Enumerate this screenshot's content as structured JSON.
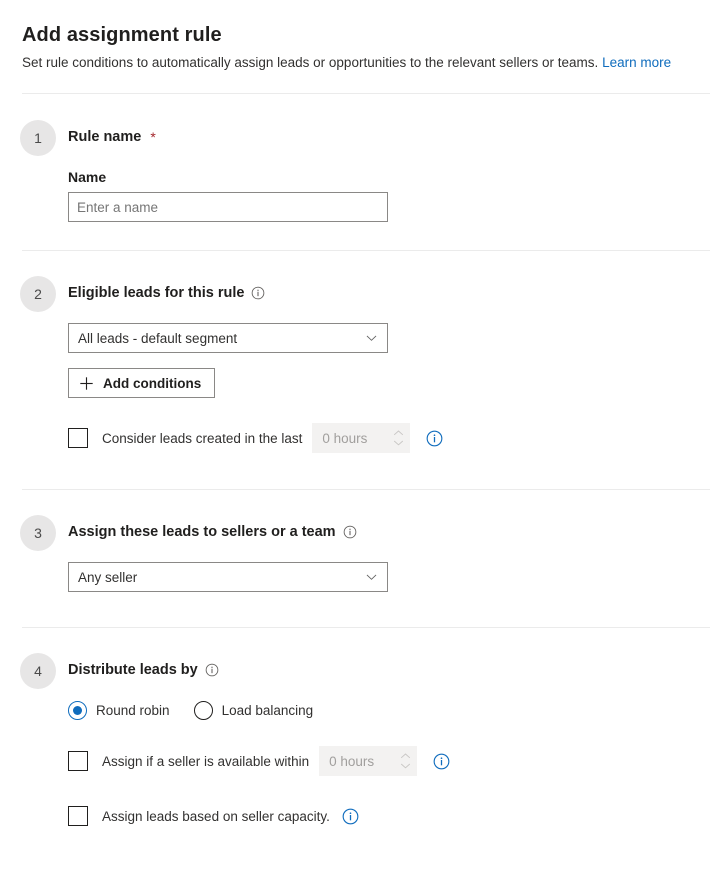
{
  "header": {
    "title": "Add assignment rule",
    "subtitle": "Set rule conditions to automatically assign leads or opportunities to the relevant sellers or teams.",
    "learn_more": "Learn more"
  },
  "colors": {
    "accent": "#0f6cbd",
    "link": "#0f6cbd",
    "required": "#a4262c",
    "step_circle_bg": "#e7e6e6",
    "divider": "#ebebeb",
    "disabled_bg": "#f3f2f1",
    "disabled_text": "#a19f9d",
    "border": "#8a8886"
  },
  "sections": [
    {
      "step": "1",
      "heading": "Rule name",
      "required": true,
      "required_mark": "*",
      "has_info_icon": false,
      "field_label": "Name",
      "input_placeholder": "Enter a name",
      "input_value": ""
    },
    {
      "step": "2",
      "heading": "Eligible leads for this rule",
      "has_info_icon": true,
      "info_icon": "info-circle-icon",
      "dropdown_value": "All leads - default segment",
      "dropdown_icon": "chevron-down-icon",
      "add_button_label": "Add conditions",
      "add_button_icon": "plus-icon",
      "checkbox_label": "Consider leads created in the last",
      "checkbox_checked": false,
      "spinner_value": "0 hours",
      "spinner_disabled": true,
      "spinner_up_icon": "chevron-up-icon",
      "spinner_down_icon": "chevron-down-icon",
      "row_info_icon": "info-circle-icon"
    },
    {
      "step": "3",
      "heading": "Assign these leads to sellers or a team",
      "has_info_icon": true,
      "info_icon": "info-circle-icon",
      "dropdown_value": "Any seller",
      "dropdown_icon": "chevron-down-icon"
    },
    {
      "step": "4",
      "heading": "Distribute leads by",
      "has_info_icon": true,
      "info_icon": "info-circle-icon",
      "radios": [
        {
          "label": "Round robin",
          "checked": true
        },
        {
          "label": "Load balancing",
          "checked": false
        }
      ],
      "availability_checkbox_label": "Assign if a seller is available within",
      "availability_checkbox_checked": false,
      "availability_spinner_value": "0 hours",
      "availability_spinner_disabled": true,
      "availability_info_icon": "info-circle-icon",
      "capacity_checkbox_label": "Assign leads based on seller capacity.",
      "capacity_checkbox_checked": false,
      "capacity_info_icon": "info-circle-icon"
    }
  ]
}
